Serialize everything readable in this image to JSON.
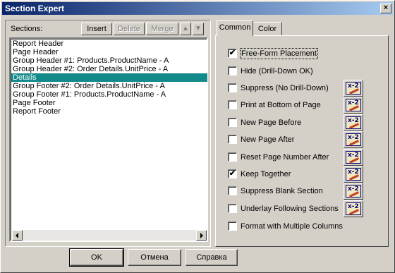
{
  "window": {
    "title": "Section Expert",
    "close_glyph": "×"
  },
  "sections": {
    "label": "Sections:",
    "toolbar": {
      "insert": "Insert",
      "delete": "Delete",
      "merge": "Merge",
      "move_up_icon": "arrow-up-icon",
      "move_down_icon": "arrow-down-icon"
    },
    "items": [
      "Report Header",
      "Page Header",
      "Group Header #1: Products.ProductName - A",
      "Group Header #2: Order Details.UnitPrice - A",
      "Details",
      "Group Footer #2: Order Details.UnitPrice - A",
      "Group Footer #1: Products.ProductName - A",
      "Page Footer",
      "Report Footer"
    ],
    "selected_index": 4
  },
  "tabs": [
    "Common",
    "Color"
  ],
  "active_tab": "Common",
  "options": [
    {
      "label": "Free-Form Placement",
      "checked": true,
      "formula": false
    },
    {
      "label": "Hide (Drill-Down OK)",
      "checked": false,
      "formula": false
    },
    {
      "label": "Suppress (No Drill-Down)",
      "checked": false,
      "formula": true
    },
    {
      "label": "Print at Bottom of Page",
      "checked": false,
      "formula": true
    },
    {
      "label": "New Page Before",
      "checked": false,
      "formula": true
    },
    {
      "label": "New Page After",
      "checked": false,
      "formula": true
    },
    {
      "label": "Reset Page Number After",
      "checked": false,
      "formula": true
    },
    {
      "label": "Keep Together",
      "checked": true,
      "formula": true
    },
    {
      "label": "Suppress Blank Section",
      "checked": false,
      "formula": true
    },
    {
      "label": "Underlay Following Sections",
      "checked": false,
      "formula": true
    },
    {
      "label": "Format with Multiple Columns",
      "checked": false,
      "formula": false
    }
  ],
  "formula_button_label": "x-2",
  "check_glyph": "✔",
  "buttons": {
    "ok": "OK",
    "cancel": "Отмена",
    "help": "Справка"
  }
}
